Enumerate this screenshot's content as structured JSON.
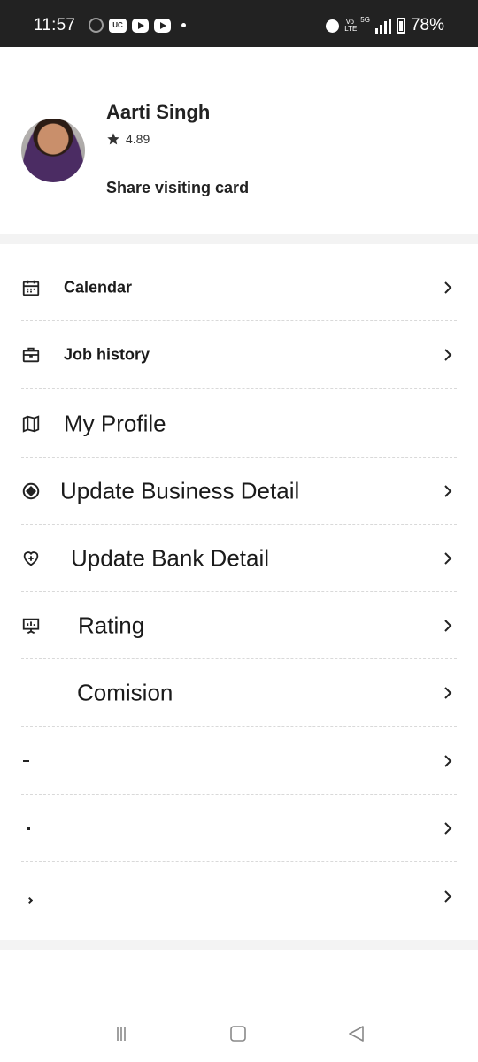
{
  "status_bar": {
    "time": "11:57",
    "left_icons": [
      "google-g-icon",
      "uc-browser-icon",
      "youtube-icon",
      "youtube-icon",
      "notification-dot-icon"
    ],
    "uc_label": "UC",
    "volte_label": "Vo LTE",
    "network_label": "5G",
    "battery_percent": "78%",
    "battery_level": 0.78
  },
  "profile": {
    "name": "Aarti Singh",
    "rating": "4.89",
    "share_label": "Share visiting card"
  },
  "menu": [
    {
      "label": "Calendar",
      "icon": "calendar-icon",
      "chevron": true
    },
    {
      "label": "Job history",
      "icon": "briefcase-icon",
      "chevron": true
    },
    {
      "label": "My Profile",
      "icon": "map-icon",
      "chevron": false
    },
    {
      "label": "Update Business Detail",
      "icon": "target-icon",
      "chevron": true
    },
    {
      "label": "Update Bank Detail",
      "icon": "heart-plus-icon",
      "chevron": true
    },
    {
      "label": "Rating",
      "icon": "presentation-icon",
      "chevron": true
    },
    {
      "label": "Comision",
      "icon": "",
      "chevron": true
    },
    {
      "label": "",
      "icon": "",
      "chevron": true
    },
    {
      "label": "",
      "icon": "",
      "chevron": true
    },
    {
      "label": "",
      "icon": "",
      "chevron": true
    }
  ],
  "nav": [
    "recents-icon",
    "home-icon",
    "back-icon"
  ],
  "colors": {
    "status_bg": "#222222",
    "text": "#1a1a1a",
    "divider": "#f3f3f3"
  }
}
